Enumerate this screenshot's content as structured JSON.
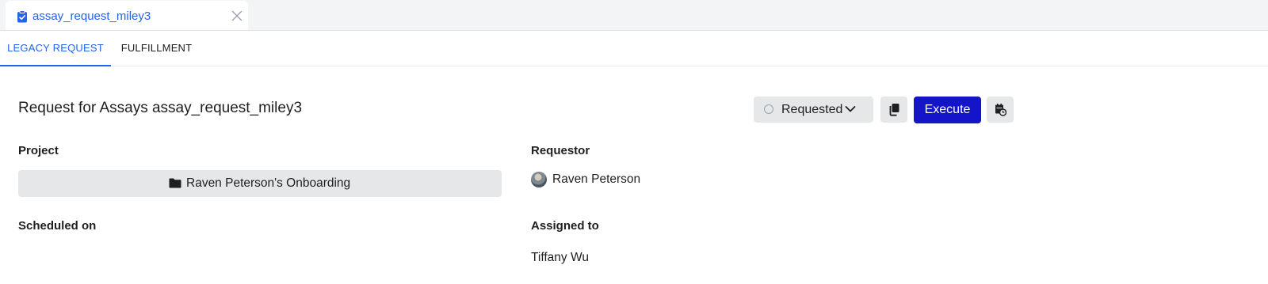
{
  "document_tab": {
    "title": "assay_request_miley3",
    "icon": "clipboard-check-icon",
    "close_icon": "close-icon"
  },
  "subtabs": [
    {
      "label": "LEGACY REQUEST",
      "active": true
    },
    {
      "label": "FULFILLMENT",
      "active": false
    }
  ],
  "header": {
    "title": "Request for Assays assay_request_miley3"
  },
  "toolbar": {
    "status_label": "Requested",
    "copy_icon": "copy-icon",
    "execute_label": "Execute",
    "schedule_icon": "calendar-clock-icon"
  },
  "fields": {
    "project_label": "Project",
    "project_value": "Raven Peterson's Onboarding",
    "requestor_label": "Requestor",
    "requestor_value": "Raven Peterson",
    "scheduled_label": "Scheduled on",
    "assigned_label": "Assigned to",
    "assigned_value": "Tiffany Wu"
  },
  "colors": {
    "accent": "#2563eb",
    "primary_button": "#1414c8",
    "neutral_button": "#e6e7e9"
  }
}
